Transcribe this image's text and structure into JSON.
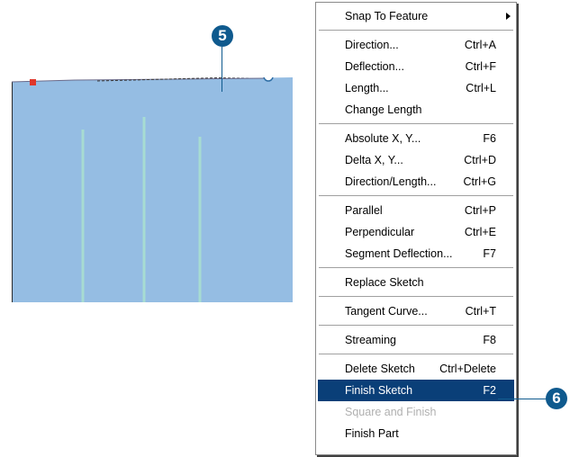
{
  "callouts": {
    "step5": "5",
    "step6": "6"
  },
  "colors": {
    "polygon_fill": "#95bde3",
    "streams": "#a7dcd2",
    "vertex_start": "#e0372b",
    "callout": "#0f5a8e",
    "menu_highlight": "#0a3f78"
  },
  "menu": {
    "snap_to_feature": {
      "label": "Snap To Feature",
      "submenu_icon": "submenu-arrow-icon"
    },
    "direction": {
      "label": "Direction...",
      "shortcut": "Ctrl+A"
    },
    "deflection": {
      "label": "Deflection...",
      "shortcut": "Ctrl+F"
    },
    "length": {
      "label": "Length...",
      "shortcut": "Ctrl+L"
    },
    "change_length": {
      "label": "Change Length",
      "shortcut": ""
    },
    "absolute_xy": {
      "label": "Absolute X, Y...",
      "shortcut": "F6"
    },
    "delta_xy": {
      "label": "Delta X, Y...",
      "shortcut": "Ctrl+D"
    },
    "direction_length": {
      "label": "Direction/Length...",
      "shortcut": "Ctrl+G"
    },
    "parallel": {
      "label": "Parallel",
      "shortcut": "Ctrl+P"
    },
    "perpendicular": {
      "label": "Perpendicular",
      "shortcut": "Ctrl+E"
    },
    "segment_deflection": {
      "label": "Segment Deflection...",
      "shortcut": "F7"
    },
    "replace_sketch": {
      "label": "Replace Sketch",
      "shortcut": ""
    },
    "tangent_curve": {
      "label": "Tangent Curve...",
      "shortcut": "Ctrl+T"
    },
    "streaming": {
      "label": "Streaming",
      "shortcut": "F8"
    },
    "delete_sketch": {
      "label": "Delete Sketch",
      "shortcut": "Ctrl+Delete"
    },
    "finish_sketch": {
      "label": "Finish Sketch",
      "shortcut": "F2",
      "state": "highlighted"
    },
    "square_and_finish": {
      "label": "Square and Finish",
      "shortcut": "",
      "state": "disabled"
    },
    "finish_part": {
      "label": "Finish Part",
      "shortcut": ""
    }
  }
}
